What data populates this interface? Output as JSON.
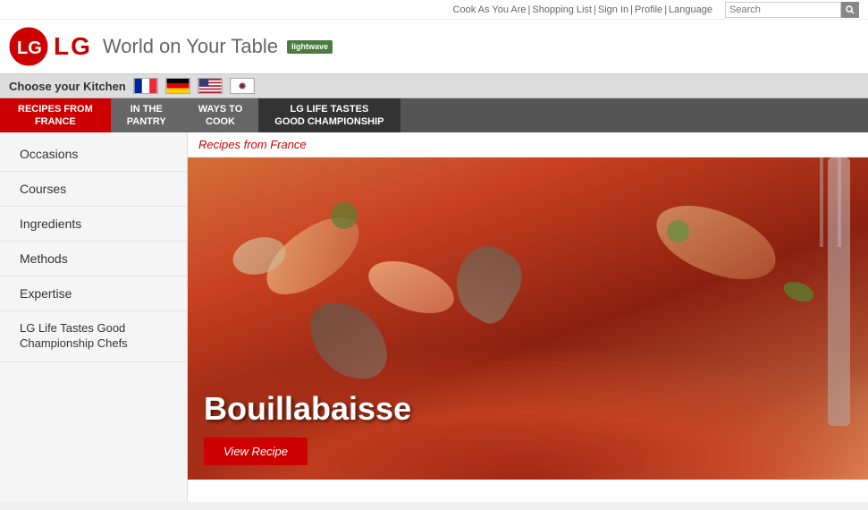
{
  "topbar": {
    "cook_as_you_are": "Cook As You Are",
    "shopping_list": "Shopping List",
    "sign_in": "Sign In",
    "profile": "Profile",
    "language": "Language",
    "search_placeholder": "Search"
  },
  "header": {
    "brand": "LG",
    "tagline": "World on Your Table",
    "lightwave": "lightwave"
  },
  "kitchen": {
    "label": "Choose your Kitchen",
    "flags": [
      "france",
      "germany",
      "usa",
      "korea"
    ]
  },
  "tabs": [
    {
      "id": "recipes-from-france",
      "label": "RECIPES FROM\nFRANCE",
      "active": true
    },
    {
      "id": "in-the-pantry",
      "label": "IN THE\nPANTRY",
      "active": false
    },
    {
      "id": "ways-to-cook",
      "label": "WAYS TO\nCOOK",
      "active": false
    },
    {
      "id": "lg-life-tastes",
      "label": "LG LIFE TASTES\nGOOD CHAMPIONSHIP",
      "active": false
    }
  ],
  "sidebar": {
    "items": [
      {
        "id": "occasions",
        "label": "Occasions"
      },
      {
        "id": "courses",
        "label": "Courses"
      },
      {
        "id": "ingredients",
        "label": "Ingredients"
      },
      {
        "id": "methods",
        "label": "Methods"
      },
      {
        "id": "expertise",
        "label": "Expertise"
      },
      {
        "id": "lg-life-tastes-chefs",
        "label": "LG Life Tastes Good Championship Chefs"
      }
    ]
  },
  "content": {
    "breadcrumb": "Recipes from France",
    "hero_title": "Bouillabaisse",
    "view_recipe_btn": "View Recipe"
  },
  "colors": {
    "active_tab": "#cc0000",
    "inactive_tab": "#666666",
    "dark_tab": "#333333",
    "accent_red": "#cc0000",
    "sidebar_bg": "#f5f5f5"
  }
}
